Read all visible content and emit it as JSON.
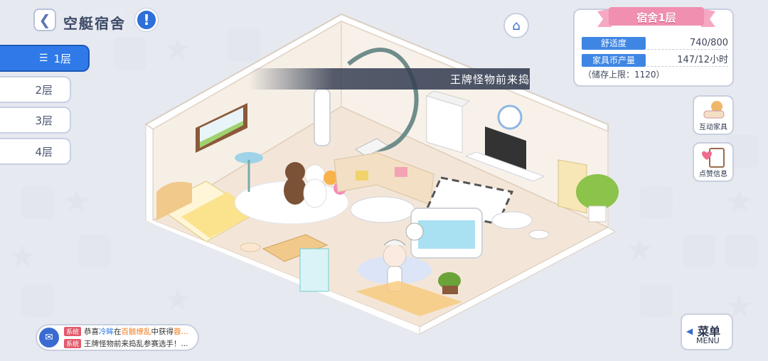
{
  "header": {
    "back_icon": "chevron-left-icon",
    "title": "空艇宿舍",
    "info_icon": "exclamation-icon"
  },
  "floors": [
    {
      "label": "1层",
      "active": true
    },
    {
      "label": "2层",
      "active": false
    },
    {
      "label": "3层",
      "active": false
    },
    {
      "label": "4层",
      "active": false
    }
  ],
  "home_icon": "home-icon",
  "banner": {
    "text": "王牌怪物前来捣"
  },
  "dorm_panel": {
    "title": "宿舍1层",
    "stats": [
      {
        "label": "舒适度",
        "value": "740/800"
      },
      {
        "label": "家具币产量",
        "value": "147/12小时"
      }
    ],
    "storage": "（储存上限：1120）"
  },
  "side_buttons": [
    {
      "label": "互动家具",
      "icon": "interactive-furniture-icon"
    },
    {
      "label": "点赞信息",
      "icon": "like-info-icon"
    }
  ],
  "menu": {
    "label_cn": "菜单",
    "label_en": "MENU"
  },
  "chat": {
    "lines": [
      {
        "tag": "系统",
        "parts": [
          "恭喜",
          "冷眸",
          "在",
          "百骸缭乱",
          "中获得",
          "蓉..."
        ]
      },
      {
        "tag": "系统",
        "text": "王牌怪物前来捣乱参赛选手！..."
      }
    ]
  },
  "colors": {
    "accent_blue": "#2f7ae8",
    "ribbon_pink": "#f08fb0",
    "tag_red": "#e25a6c"
  }
}
